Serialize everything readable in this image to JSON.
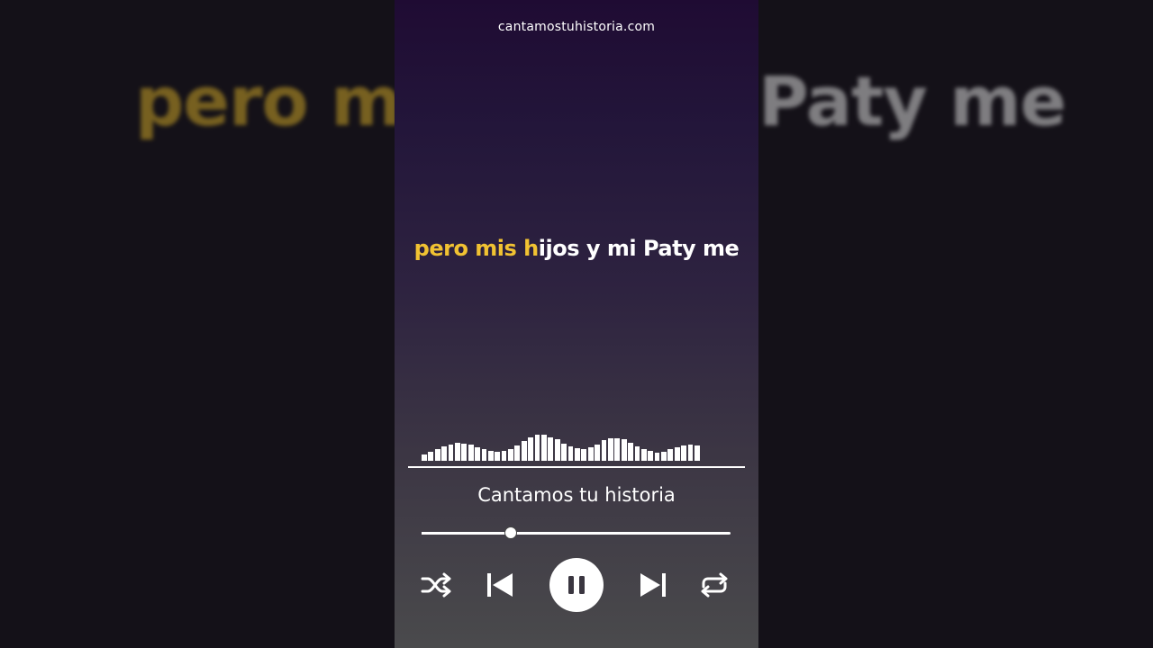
{
  "background": {
    "left_text": "pero mis",
    "right_text": "Paty me"
  },
  "site_url": "cantamostuhistoria.com",
  "lyric": {
    "sung": "pero mis h",
    "unsung": "ijos y mi Paty me"
  },
  "equalizer_levels": [
    0.17,
    0.24,
    0.3,
    0.38,
    0.44,
    0.48,
    0.46,
    0.42,
    0.36,
    0.3,
    0.27,
    0.24,
    0.27,
    0.3,
    0.4,
    0.52,
    0.63,
    0.68,
    0.68,
    0.63,
    0.56,
    0.46,
    0.38,
    0.34,
    0.32,
    0.36,
    0.44,
    0.54,
    0.6,
    0.6,
    0.56,
    0.48,
    0.38,
    0.3,
    0.25,
    0.22,
    0.24,
    0.3,
    0.36,
    0.4,
    0.42,
    0.4
  ],
  "track": {
    "title": "Cantamos tu historia",
    "progress": 0.29
  },
  "controls": {
    "shuffle": "shuffle-icon",
    "previous": "skip-previous-icon",
    "play_pause": "pause-icon",
    "next": "skip-next-icon",
    "repeat": "repeat-icon"
  },
  "colors": {
    "sung": "#f1c232",
    "unsung": "#ffffff",
    "gradient_top": "#1f0b33",
    "gradient_bottom": "#4a4a4c"
  }
}
